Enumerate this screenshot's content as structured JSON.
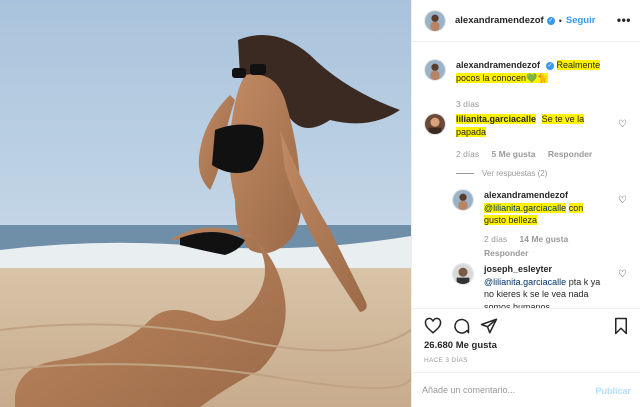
{
  "post": {
    "username": "alexandramendezof",
    "follow_label": "Seguir",
    "separator": "•",
    "more_label": "•••"
  },
  "caption": {
    "username": "alexandramendezof",
    "text": "Realmente pocos la conocen",
    "emoji": "💚🐈",
    "time": "3 días"
  },
  "comments": [
    {
      "username": "lilianita.garciacalle",
      "text": "Se te ve la papada",
      "time": "2 días",
      "likes": "5 Me gusta",
      "reply_label": "Responder",
      "view_replies": "Ver respuestas (2)"
    },
    {
      "username": "alexandramendezof",
      "mention": "@lilianita.garciacalle",
      "text": "con gusto belleza",
      "time": "2 días",
      "likes": "14 Me gusta",
      "reply_label": "Responder"
    },
    {
      "username": "joseph_esleyter",
      "mention": "@lilianita.garciacalle",
      "text": "pta k ya no kieres k se le vea nada somos humanos"
    }
  ],
  "likes_count": "26.680 Me gusta",
  "time_ago": "HACE 3 DÍAS",
  "add_comment": {
    "placeholder": "Añade un comentario...",
    "publish_label": "Publicar"
  },
  "colors": {
    "link_blue": "#3897f0",
    "highlight": "#fff200",
    "publish_disabled": "#b2dffc"
  }
}
